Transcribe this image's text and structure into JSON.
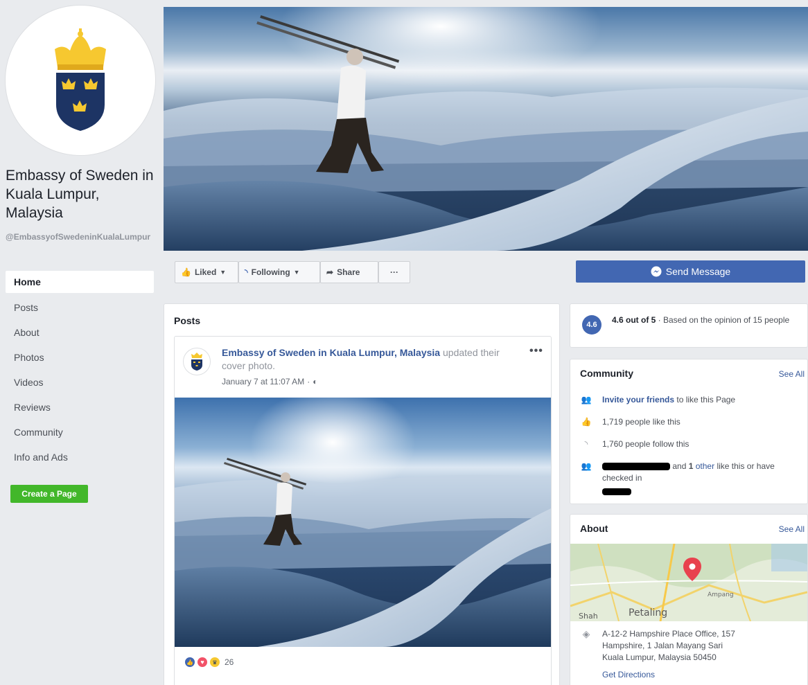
{
  "page": {
    "name": "Embassy of Sweden in Kuala Lumpur, Malaysia",
    "handle": "@EmbassyofSwedeninKualaLumpur"
  },
  "nav": {
    "items": [
      "Home",
      "Posts",
      "About",
      "Photos",
      "Videos",
      "Reviews",
      "Community",
      "Info and Ads"
    ],
    "active": "Home"
  },
  "create_page_label": "Create a Page",
  "actions": {
    "liked": "Liked",
    "following": "Following",
    "share": "Share",
    "more": "···",
    "send_message": "Send Message"
  },
  "posts": {
    "title": "Posts",
    "author": "Embassy of Sweden in Kuala Lumpur, Malaysia",
    "action_text": "updated their cover photo.",
    "timestamp": "January 7 at 11:07 AM",
    "more": "•••",
    "reaction_count": "26"
  },
  "rating": {
    "score": "4.6",
    "summary": "4.6 out of 5",
    "detail": " · Based on the opinion of 15 people"
  },
  "community": {
    "title": "Community",
    "see_all": "See All",
    "invite_link": "Invite your friends",
    "invite_rest": "to like this Page",
    "likes": "1,719 people like this",
    "follows": "1,760 people follow this",
    "friends_and": "and",
    "friends_count": "1",
    "friends_other": "other",
    "friends_rest": "like this or have",
    "checked_in": "checked in"
  },
  "about": {
    "title": "About",
    "see_all": "See All",
    "map_labels": [
      "Ampang",
      "Petaling",
      "Shah"
    ],
    "address_lines": [
      "A-12-2 Hampshire Place Office, 157",
      "Hampshire, 1 Jalan Mayang Sari",
      "Kuala Lumpur, Malaysia 50450"
    ],
    "directions": "Get Directions"
  },
  "colors": {
    "brand_blue": "#4267b2",
    "link_blue": "#365899",
    "create_green": "#42b72a",
    "crest_blue": "#1d3464",
    "crest_gold": "#f6c830"
  }
}
